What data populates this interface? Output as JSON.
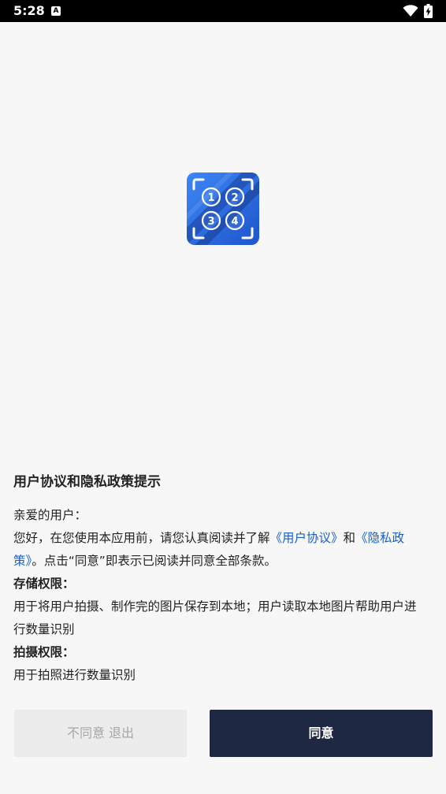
{
  "status_bar": {
    "time": "5:28",
    "notification_icon_letter": "A"
  },
  "dialog": {
    "title": "用户协议和隐私政策提示",
    "greeting": "亲爱的用户：",
    "intro_prefix": "您好，在您使用本应用前，请您认真阅读并了解",
    "user_agreement_link": "《用户协议》",
    "and_text": "和",
    "privacy_policy_link": "《隐私政策》",
    "intro_suffix": "。点击“同意”即表示已阅读并同意全部条款。",
    "storage_title": "存储权限：",
    "storage_desc": "用于将用户拍摄、制作完的图片保存到本地；用户读取本地图片帮助用户进行数量识别",
    "camera_title": "拍摄权限：",
    "camera_desc": "用于拍照进行数量识别"
  },
  "buttons": {
    "decline_label": "不同意 退出",
    "agree_label": "同意"
  },
  "logo": {
    "numbers": [
      "1",
      "2",
      "3",
      "4"
    ]
  },
  "colors": {
    "accent_blue": "#2f6fe0",
    "link_blue": "#1a5fc8",
    "agree_button": "#1f2843",
    "decline_button": "#ececec"
  }
}
